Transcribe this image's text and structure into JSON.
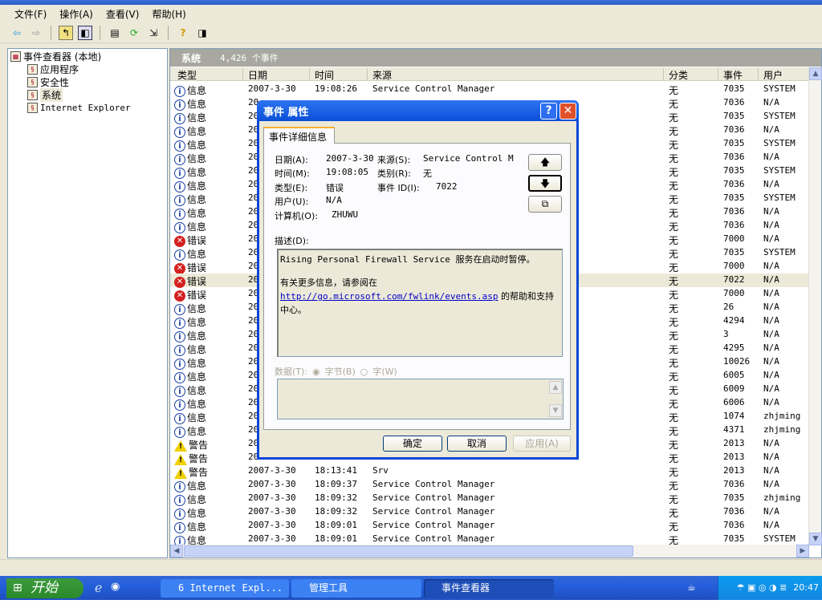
{
  "menu": [
    "文件(F)",
    "操作(A)",
    "查看(V)",
    "帮助(H)"
  ],
  "toolbar_icons": [
    "back-icon",
    "forward-icon",
    "up-folder-icon",
    "show-tree-icon",
    "properties-icon",
    "refresh-icon",
    "export-icon",
    "help-icon",
    "action-pane-icon"
  ],
  "tree": {
    "root": "事件查看器 (本地)",
    "items": [
      "应用程序",
      "安全性",
      "系统",
      "Internet Explorer"
    ]
  },
  "panel": {
    "title": "系统",
    "count": "4,426 个事件"
  },
  "columns": [
    "类型",
    "日期",
    "时间",
    "来源",
    "分类",
    "事件",
    "用户"
  ],
  "type_labels": {
    "info": "信息",
    "err": "错误",
    "warn": "警告"
  },
  "rows": [
    {
      "t": "info",
      "d": "2007-3-30",
      "tm": "19:08:26",
      "s": "Service Control Manager",
      "c": "无",
      "e": "7035",
      "u": "SYSTEM"
    },
    {
      "t": "info",
      "d": "20",
      "tm": "",
      "s": "",
      "c": "无",
      "e": "7036",
      "u": "N/A"
    },
    {
      "t": "info",
      "d": "20",
      "tm": "",
      "s": "",
      "c": "无",
      "e": "7035",
      "u": "SYSTEM"
    },
    {
      "t": "info",
      "d": "20",
      "tm": "",
      "s": "",
      "c": "无",
      "e": "7036",
      "u": "N/A"
    },
    {
      "t": "info",
      "d": "20",
      "tm": "",
      "s": "",
      "c": "无",
      "e": "7035",
      "u": "SYSTEM"
    },
    {
      "t": "info",
      "d": "20",
      "tm": "",
      "s": "",
      "c": "无",
      "e": "7036",
      "u": "N/A"
    },
    {
      "t": "info",
      "d": "20",
      "tm": "",
      "s": "",
      "c": "无",
      "e": "7035",
      "u": "SYSTEM"
    },
    {
      "t": "info",
      "d": "20",
      "tm": "",
      "s": "",
      "c": "无",
      "e": "7036",
      "u": "N/A"
    },
    {
      "t": "info",
      "d": "20",
      "tm": "",
      "s": "",
      "c": "无",
      "e": "7035",
      "u": "SYSTEM"
    },
    {
      "t": "info",
      "d": "20",
      "tm": "",
      "s": "",
      "c": "无",
      "e": "7036",
      "u": "N/A"
    },
    {
      "t": "info",
      "d": "20",
      "tm": "",
      "s": "",
      "c": "无",
      "e": "7036",
      "u": "N/A"
    },
    {
      "t": "err",
      "d": "20",
      "tm": "",
      "s": "",
      "c": "无",
      "e": "7000",
      "u": "N/A"
    },
    {
      "t": "info",
      "d": "20",
      "tm": "",
      "s": "",
      "c": "无",
      "e": "7035",
      "u": "SYSTEM"
    },
    {
      "t": "err",
      "d": "20",
      "tm": "",
      "s": "",
      "c": "无",
      "e": "7000",
      "u": "N/A"
    },
    {
      "t": "err",
      "d": "20",
      "tm": "",
      "s": "",
      "c": "无",
      "e": "7022",
      "u": "N/A",
      "sel": true
    },
    {
      "t": "err",
      "d": "20",
      "tm": "",
      "s": "",
      "c": "无",
      "e": "7000",
      "u": "N/A"
    },
    {
      "t": "info",
      "d": "20",
      "tm": "",
      "s": "",
      "c": "无",
      "e": "26",
      "u": "N/A"
    },
    {
      "t": "info",
      "d": "20",
      "tm": "",
      "s": "",
      "c": "无",
      "e": "4294",
      "u": "N/A"
    },
    {
      "t": "info",
      "d": "20",
      "tm": "",
      "s": "",
      "c": "无",
      "e": "3",
      "u": "N/A"
    },
    {
      "t": "info",
      "d": "20",
      "tm": "",
      "s": "",
      "c": "无",
      "e": "4295",
      "u": "N/A"
    },
    {
      "t": "info",
      "d": "20",
      "tm": "",
      "s": "",
      "c": "无",
      "e": "10026",
      "u": "N/A"
    },
    {
      "t": "info",
      "d": "20",
      "tm": "",
      "s": "",
      "c": "无",
      "e": "6005",
      "u": "N/A"
    },
    {
      "t": "info",
      "d": "20",
      "tm": "",
      "s": "",
      "c": "无",
      "e": "6009",
      "u": "N/A"
    },
    {
      "t": "info",
      "d": "20",
      "tm": "",
      "s": "",
      "c": "无",
      "e": "6006",
      "u": "N/A"
    },
    {
      "t": "info",
      "d": "20",
      "tm": "",
      "s": "",
      "c": "无",
      "e": "1074",
      "u": "zhjming"
    },
    {
      "t": "info",
      "d": "20",
      "tm": "",
      "s": "",
      "c": "无",
      "e": "4371",
      "u": "zhjming"
    },
    {
      "t": "warn",
      "d": "20",
      "tm": "",
      "s": "",
      "c": "无",
      "e": "2013",
      "u": "N/A"
    },
    {
      "t": "warn",
      "d": "20",
      "tm": "",
      "s": "",
      "c": "无",
      "e": "2013",
      "u": "N/A"
    },
    {
      "t": "warn",
      "d": "2007-3-30",
      "tm": "18:13:41",
      "s": "Srv",
      "c": "无",
      "e": "2013",
      "u": "N/A"
    },
    {
      "t": "info",
      "d": "2007-3-30",
      "tm": "18:09:37",
      "s": "Service Control Manager",
      "c": "无",
      "e": "7036",
      "u": "N/A"
    },
    {
      "t": "info",
      "d": "2007-3-30",
      "tm": "18:09:32",
      "s": "Service Control Manager",
      "c": "无",
      "e": "7035",
      "u": "zhjming"
    },
    {
      "t": "info",
      "d": "2007-3-30",
      "tm": "18:09:32",
      "s": "Service Control Manager",
      "c": "无",
      "e": "7036",
      "u": "N/A"
    },
    {
      "t": "info",
      "d": "2007-3-30",
      "tm": "18:09:01",
      "s": "Service Control Manager",
      "c": "无",
      "e": "7036",
      "u": "N/A"
    },
    {
      "t": "info",
      "d": "2007-3-30",
      "tm": "18:09:01",
      "s": "Service Control Manager",
      "c": "无",
      "e": "7035",
      "u": "SYSTEM"
    }
  ],
  "dialog": {
    "title": "事件 属性",
    "tab": "事件详细信息",
    "date_label": "日期(A):",
    "date": "2007-3-30",
    "source_label": "来源(S):",
    "source": "Service Control M",
    "time_label": "时间(M):",
    "time": "19:08:05",
    "category_label": "类别(R):",
    "category": "无",
    "type_label": "类型(E):",
    "type": "错误",
    "event_label": "事件 ID(I):",
    "event": "7022",
    "user_label": "用户(U):",
    "user": "N/A",
    "computer_label": "计算机(O):",
    "computer": "ZHUWU",
    "desc_label": "描述(D):",
    "desc_line1": "Rising Personal Firewall Service 服务在启动时暂停。",
    "desc_line2": "有关更多信息，请参阅在",
    "desc_link": "http://go.microsoft.com/fwlink/events.asp",
    "desc_line3": " 的帮助和支持中心。",
    "data_label": "数据(T):",
    "bytes_label": "字节(B)",
    "words_label": "字(W)",
    "ok": "确定",
    "cancel": "取消",
    "apply": "应用(A)",
    "help_btn": "?",
    "close_btn": "✕"
  },
  "taskbar": {
    "start": "开始",
    "tasks": [
      "6 Internet Expl...",
      "管理工具",
      "事件查看器"
    ],
    "clock": "20:47"
  }
}
